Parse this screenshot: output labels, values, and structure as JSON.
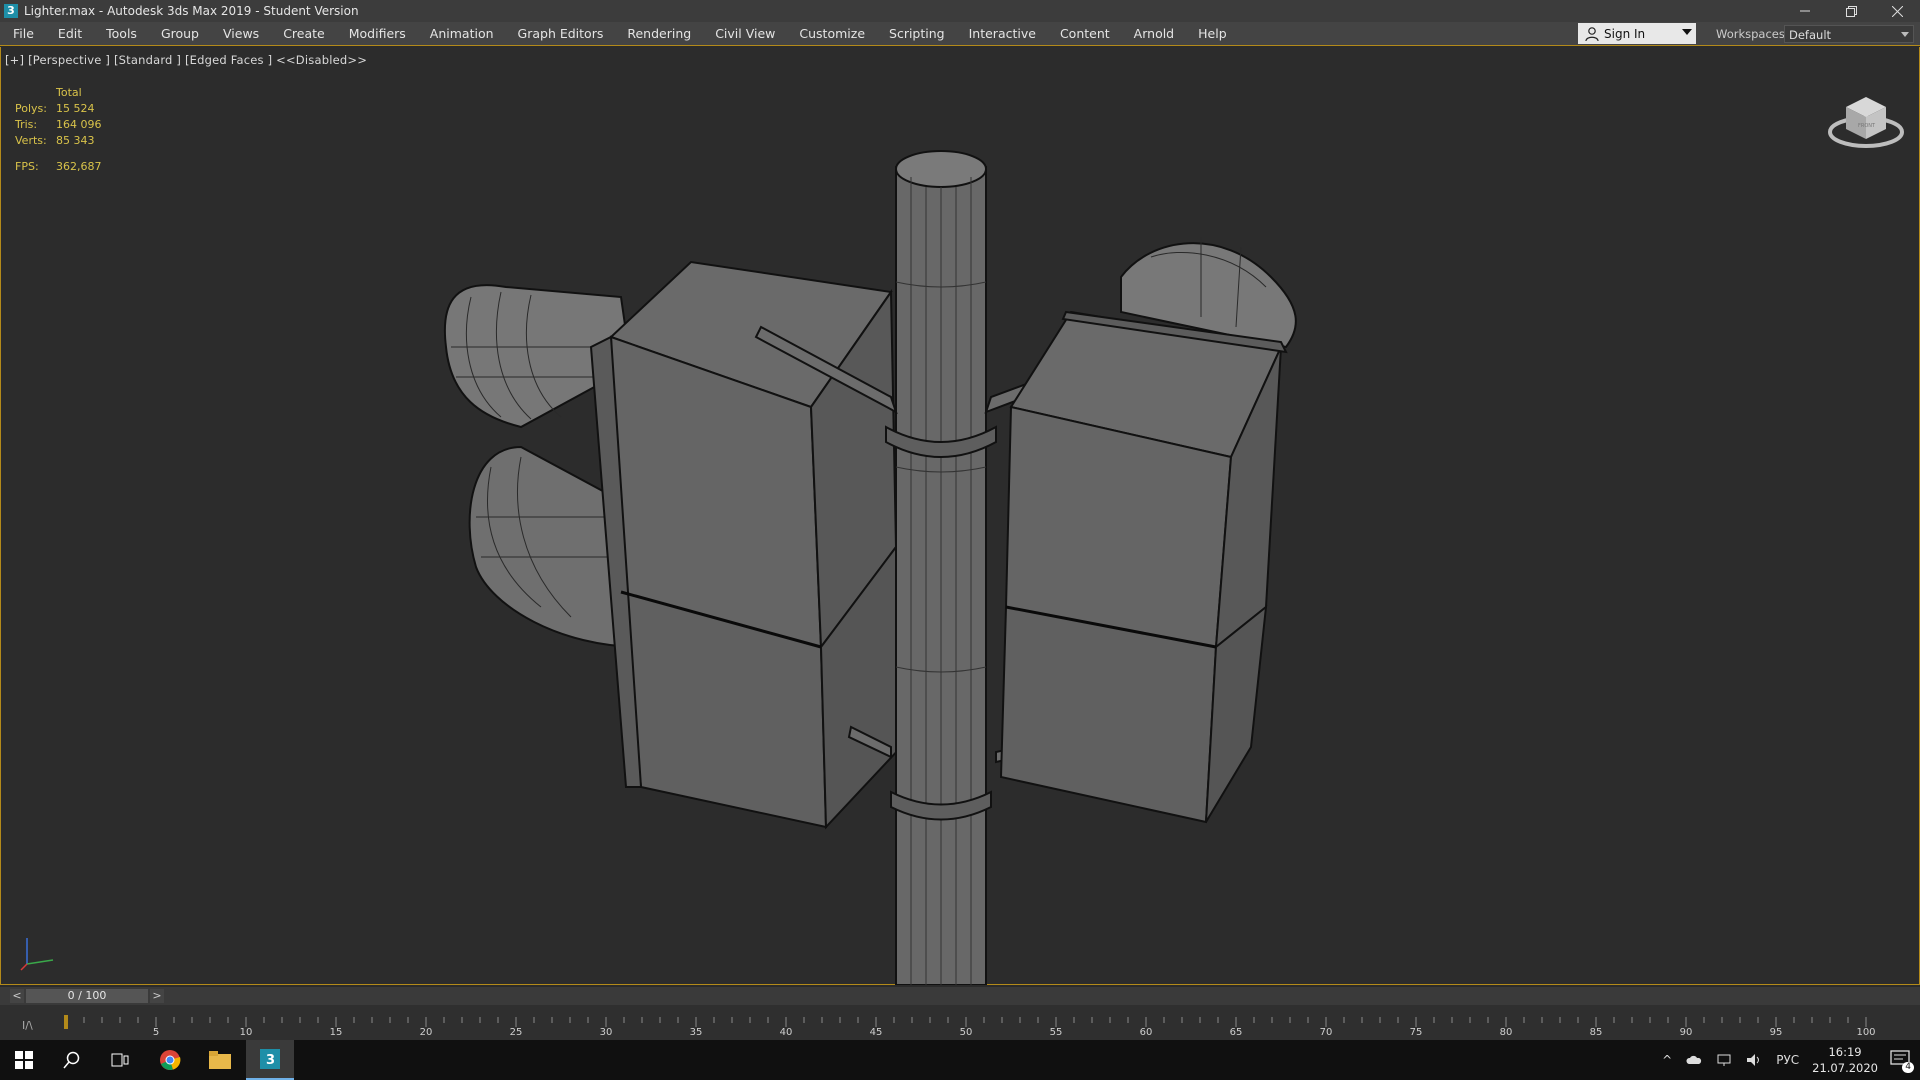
{
  "window": {
    "title": "Lighter.max - Autodesk 3ds Max 2019 - Student Version",
    "app_icon_glyph": "3",
    "controls": [
      "minimize-icon",
      "restore-icon",
      "close-icon"
    ]
  },
  "menu": {
    "items": [
      "File",
      "Edit",
      "Tools",
      "Group",
      "Views",
      "Create",
      "Modifiers",
      "Animation",
      "Graph Editors",
      "Rendering",
      "Civil View",
      "Customize",
      "Scripting",
      "Interactive",
      "Content",
      "Arnold",
      "Help"
    ],
    "sign_in": "Sign In",
    "workspaces_label": "Workspaces:",
    "workspace_value": "Default"
  },
  "viewport": {
    "label": "[+] [Perspective ] [Standard ] [Edged Faces ]  <<Disabled>>",
    "stats": {
      "header": "Total",
      "polys_label": "Polys:",
      "polys": "15 524",
      "tris_label": "Tris:",
      "tris": "164 096",
      "verts_label": "Verts:",
      "verts": "85 343",
      "fps_label": "FPS:",
      "fps": "362,687"
    },
    "viewcube_face": "FRONT"
  },
  "timeline": {
    "frame_display": "0 / 100",
    "prev": "<",
    "next": ">",
    "ticks": [
      "5",
      "10",
      "15",
      "20",
      "25",
      "30",
      "35",
      "40",
      "45",
      "50",
      "55",
      "60",
      "65",
      "70",
      "75",
      "80",
      "85",
      "90",
      "95",
      "100"
    ]
  },
  "taskbar": {
    "language": "РУС",
    "time": "16:19",
    "date": "21.07.2020",
    "notifications": "4"
  },
  "colors": {
    "accent": "#b38a1a",
    "stats_text": "#d9c34a",
    "viewport_bg": "#2c2c2c"
  }
}
